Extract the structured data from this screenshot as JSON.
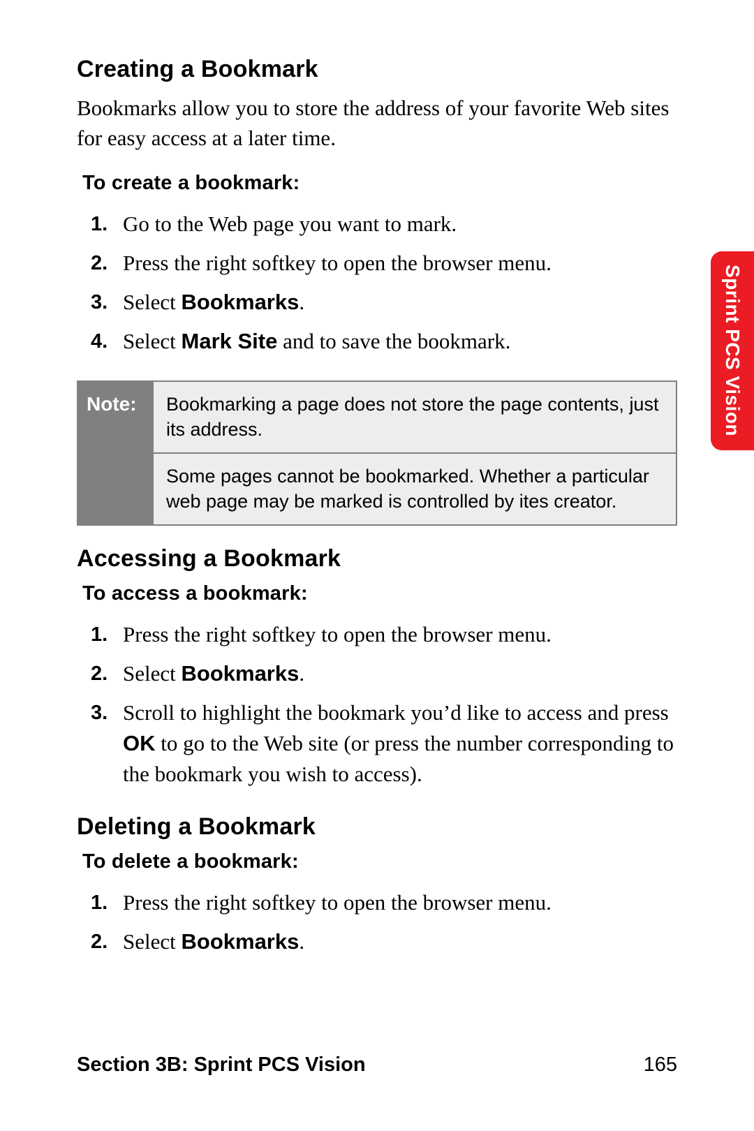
{
  "side_tab": "Sprint PCS Vision",
  "footer": {
    "section": "Section 3B: Sprint PCS Vision",
    "page": "165"
  },
  "s1": {
    "title": "Creating a Bookmark",
    "intro": "Bookmarks allow you to store the address of your favorite Web sites for easy access at a later time.",
    "lead": "To create a bookmark:",
    "step1": "Go to the Web page you want to mark.",
    "step2": "Press the right softkey to open the browser menu.",
    "step3a": "Select ",
    "step3b": "Bookmarks",
    "step3c": ".",
    "step4a": "Select ",
    "step4b": "Mark Site",
    "step4c": " and to save the bookmark."
  },
  "note": {
    "label": "Note:",
    "row1": "Bookmarking a page does not store the page contents, just its address.",
    "row2": "Some pages cannot be bookmarked. Whether a particular web page may be marked is controlled by ites creator."
  },
  "s2": {
    "title": "Accessing a Bookmark",
    "lead": "To access a bookmark:",
    "step1": "Press the right softkey to open the browser menu.",
    "step2a": "Select ",
    "step2b": "Bookmarks",
    "step2c": ".",
    "step3a": "Scroll to highlight the bookmark you’d like to access and press ",
    "step3b": "OK",
    "step3c": " to go to the Web site (or press the number corresponding to the bookmark you wish to access)."
  },
  "s3": {
    "title": "Deleting a Bookmark",
    "lead": "To delete a bookmark:",
    "step1": "Press the right softkey to open the browser menu.",
    "step2a": "Select ",
    "step2b": "Bookmarks",
    "step2c": "."
  }
}
